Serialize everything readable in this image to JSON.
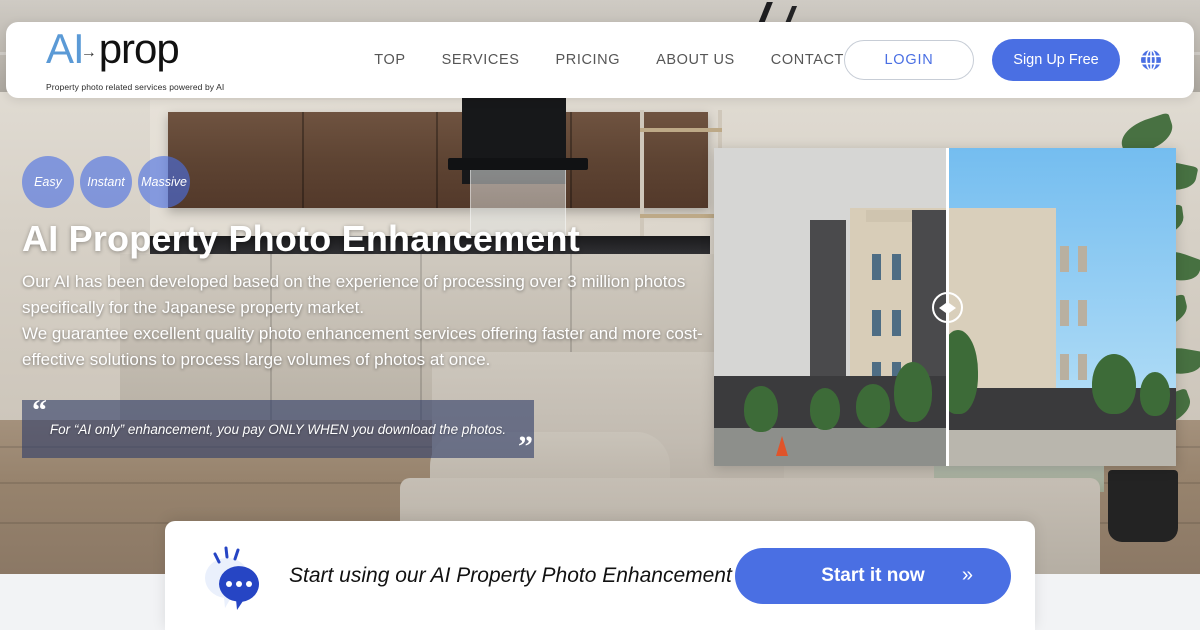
{
  "header": {
    "logo": {
      "ai": "AI",
      "arrow": "→",
      "prop": "prop",
      "tagline": "Property photo related services powered by AI"
    },
    "nav": [
      {
        "label": "TOP"
      },
      {
        "label": "SERVICES"
      },
      {
        "label": "PRICING"
      },
      {
        "label": "ABOUT US"
      },
      {
        "label": "CONTACT"
      }
    ],
    "login_label": "LOGIN",
    "signup_label": "Sign Up Free",
    "language_icon": "globe-icon"
  },
  "hero": {
    "badges": [
      {
        "label": "Easy"
      },
      {
        "label": "Instant"
      },
      {
        "label": "Massive"
      }
    ],
    "headline": "AI Property Photo Enhancement",
    "subcopy": "Our AI has been developed based on the experience of processing over 3 million photos specifically for the Japanese property market.\nWe guarantee excellent quality photo enhancement services offering faster and more cost-effective solutions to process large volumes of photos at once.",
    "quote": {
      "open_mark": "“",
      "text": "For “AI only” enhancement, you pay ONLY WHEN you download the photos.",
      "close_mark": "”"
    }
  },
  "comparison": {
    "before_label": "before-photo-unenhanced-sky",
    "after_label": "after-photo-enhanced-blue-sky",
    "handle_icon": "slider-handle-icon"
  },
  "cta": {
    "icon": "chat-bubble-icon",
    "text": "Start using our AI Property Photo Enhancement",
    "button_label": "Start it now",
    "button_chevron": "»"
  },
  "colors": {
    "brand_blue": "#4a6fe3",
    "logo_blue": "#5b9ad6",
    "quote_bg": "rgba(50,63,105,.62)",
    "page_bg": "#f2f3f5"
  }
}
